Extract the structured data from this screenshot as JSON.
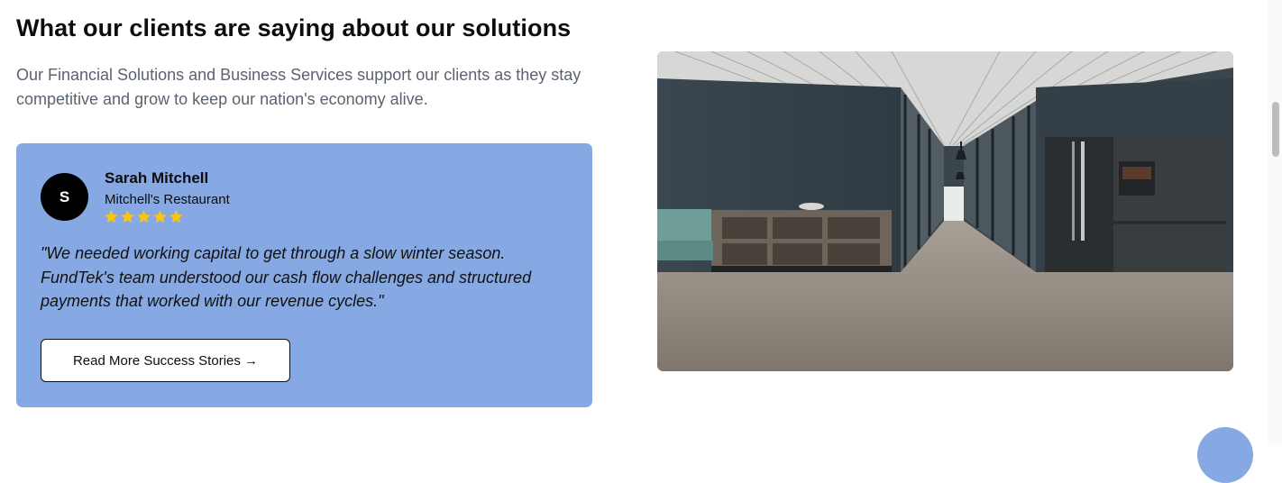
{
  "section": {
    "heading": "What our clients are saying about our solutions",
    "subtext": "Our Financial Solutions and Business Services support our clients as they stay competitive and grow to keep our nation's economy alive."
  },
  "testimonial": {
    "avatar_initial": "S",
    "name": "Sarah Mitchell",
    "company": "Mitchell's Restaurant",
    "rating": 5,
    "quote": "\"We needed working capital to get through a slow winter season. FundTek's team understood our cash flow challenges and structured payments that worked with our revenue cycles.\"",
    "cta_label": "Read More Success Stories →"
  },
  "colors": {
    "card_background": "#86a9e3",
    "star": "#f5c518",
    "heading": "#0d0d0d",
    "subtext": "#5b6270"
  },
  "image": {
    "icon": "office-interior-photo"
  }
}
